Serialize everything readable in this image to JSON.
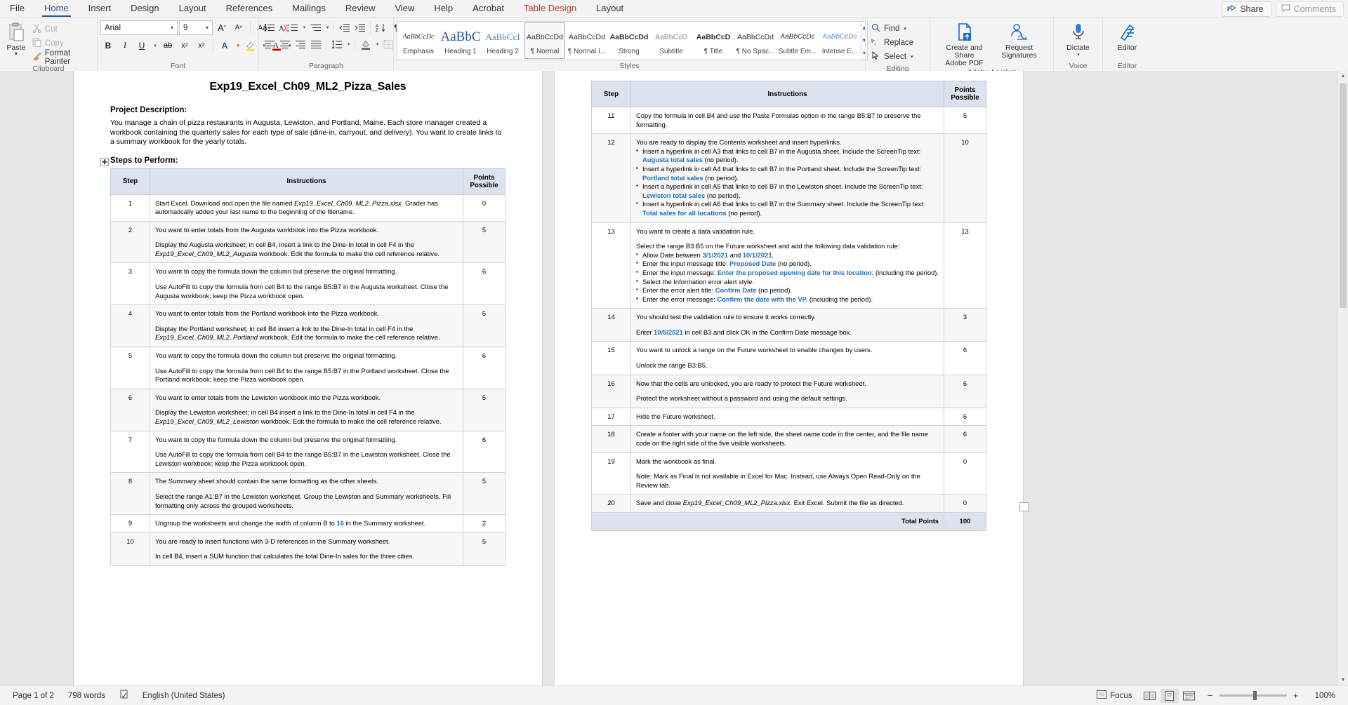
{
  "tabs": [
    {
      "label": "File",
      "state": "normal"
    },
    {
      "label": "Home",
      "state": "active"
    },
    {
      "label": "Insert",
      "state": "normal"
    },
    {
      "label": "Design",
      "state": "normal"
    },
    {
      "label": "Layout",
      "state": "normal"
    },
    {
      "label": "References",
      "state": "normal"
    },
    {
      "label": "Mailings",
      "state": "normal"
    },
    {
      "label": "Review",
      "state": "normal"
    },
    {
      "label": "View",
      "state": "normal"
    },
    {
      "label": "Help",
      "state": "normal"
    },
    {
      "label": "Acrobat",
      "state": "normal"
    }
  ],
  "contextual_tabs": [
    {
      "label": "Table Design"
    },
    {
      "label": "Layout"
    }
  ],
  "window_buttons": {
    "share": "Share",
    "comments": "Comments"
  },
  "ribbon": {
    "clipboard": {
      "label": "Clipboard",
      "paste": "Paste",
      "cut": "Cut",
      "copy": "Copy",
      "format_painter": "Format Painter"
    },
    "font": {
      "label": "Font",
      "font_name": "Arial",
      "font_size": "9",
      "grow_font": "A",
      "shrink_font": "A",
      "change_case": "Aa",
      "clear_formatting": "clear",
      "bold": "B",
      "italic": "I",
      "underline": "U",
      "strikethrough": "ab",
      "subscript": "x",
      "superscript": "x",
      "text_effects": "A",
      "highlight": "pen",
      "font_color": "A"
    },
    "paragraph": {
      "label": "Paragraph"
    },
    "styles": {
      "label": "Styles",
      "items": [
        {
          "preview": "AaBbCcDc",
          "name": "Emphasis",
          "style": "italic-serif",
          "selected": false
        },
        {
          "preview": "AaBbC",
          "name": "Heading 1",
          "style": "h1",
          "selected": false
        },
        {
          "preview": "AaBbCcI",
          "name": "Heading 2",
          "style": "h2",
          "selected": false
        },
        {
          "preview": "AaBbCcDd",
          "name": "¶ Normal",
          "style": "normal",
          "selected": true
        },
        {
          "preview": "AaBbCcDd",
          "name": "¶ Normal I...",
          "style": "normal",
          "selected": false
        },
        {
          "preview": "AaBbCcDd",
          "name": "Strong",
          "style": "bold",
          "selected": false
        },
        {
          "preview": "AaBbCcD",
          "name": "Subtitle",
          "style": "subtitle",
          "selected": false
        },
        {
          "preview": "AaBbCcD",
          "name": "¶ Title",
          "style": "bold",
          "selected": false
        },
        {
          "preview": "AaBbCcDd",
          "name": "¶ No Spac...",
          "style": "normal",
          "selected": false
        },
        {
          "preview": "AaBbCcDc",
          "name": "Subtle Em...",
          "style": "italic",
          "selected": false
        },
        {
          "preview": "AaBbCcDc",
          "name": "Intense E...",
          "style": "italic-blue",
          "selected": false
        }
      ]
    },
    "editing": {
      "label": "Editing",
      "find": "Find",
      "replace": "Replace",
      "select": "Select"
    },
    "acrobat": {
      "label": "Adobe Acrobat",
      "create_share": "Create and Share\nAdobe PDF",
      "create_share_l1": "Create and Share",
      "create_share_l2": "Adobe PDF",
      "request_sig_l1": "Request",
      "request_sig_l2": "Signatures"
    },
    "voice": {
      "label": "Voice",
      "dictate": "Dictate"
    },
    "editor": {
      "label": "Editor",
      "editor": "Editor"
    }
  },
  "document": {
    "title": "Exp19_Excel_Ch09_ML2_Pizza_Sales",
    "project_description_heading": "Project Description:",
    "project_description_body": "You manage a chain of pizza restaurants in Augusta, Lewiston, and Portland, Maine. Each store manager created a workbook containing the quarterly sales for each type of sale (dine-in, carryout, and delivery). You want to create links to a summary workbook for the yearly totals.",
    "steps_heading": "Steps to Perform:",
    "table_headers": {
      "step": "Step",
      "instructions": "Instructions",
      "points": "Points Possible",
      "points_l1": "Points",
      "points_l2": "Possible"
    },
    "total_points_label": "Total Points",
    "total_points_value": "100",
    "steps_page1": [
      {
        "step": "1",
        "points": "0",
        "paras": [
          [
            {
              "t": "Start Excel. Download and open the file named ",
              "s": "n"
            },
            {
              "t": "Exp19_Excel_Ch09_ML2_Pizza.xlsx",
              "s": "i"
            },
            {
              "t": ". Grader has automatically added your last name to the beginning of the filename.",
              "s": "n"
            }
          ]
        ]
      },
      {
        "step": "2",
        "points": "5",
        "paras": [
          [
            {
              "t": "You want to  enter totals from the Augusta workbook into the Pizza workbook.",
              "s": "n"
            }
          ],
          [
            {
              "t": "Display the Augusta worksheet; in cell B4, insert a link to the Dine-In total in cell F4 in the ",
              "s": "n"
            },
            {
              "t": "Exp19_Excel_Ch09_ML2_Augusta",
              "s": "i"
            },
            {
              "t": " workbook. Edit the formula to make the cell reference relative.",
              "s": "n"
            }
          ]
        ]
      },
      {
        "step": "3",
        "points": "6",
        "paras": [
          [
            {
              "t": "You want to  copy the formula down the column but preserve the original formatting.",
              "s": "n"
            }
          ],
          [
            {
              "t": "Use AutoFill to copy the formula from cell B4 to the range B5:B7 in the Augusta worksheet. Close the Augusta workbook; keep the Pizza workbook open.",
              "s": "n"
            }
          ]
        ]
      },
      {
        "step": "4",
        "points": "5",
        "paras": [
          [
            {
              "t": "You want to  enter totals from the Portland workbook into the Pizza workbook.",
              "s": "n"
            }
          ],
          [
            {
              "t": "Display the Portland worksheet; in cell B4 insert a link to the Dine-In total in cell F4 in the ",
              "s": "n"
            },
            {
              "t": "Exp19_Excel_Ch09_ML2_Portland",
              "s": "i"
            },
            {
              "t": " workbook. Edit the formula to make the cell reference relative.",
              "s": "n"
            }
          ]
        ]
      },
      {
        "step": "5",
        "points": "6",
        "paras": [
          [
            {
              "t": "You want to  copy the formula down the column but preserve the original formatting.",
              "s": "n"
            }
          ],
          [
            {
              "t": "Use AutoFill to copy the formula from cell B4 to the range B5:B7 in the Portland worksheet. Close the Portland workbook; keep the Pizza workbook open.",
              "s": "n"
            }
          ]
        ]
      },
      {
        "step": "6",
        "points": "5",
        "paras": [
          [
            {
              "t": "You want to  enter totals from the Lewiston workbook into the Pizza workbook.",
              "s": "n"
            }
          ],
          [
            {
              "t": "Display the Lewiston worksheet; in cell B4 insert a link to the Dine-In total in cell F4 in the ",
              "s": "n"
            },
            {
              "t": "Exp19_Excel_Ch09_ML2_Lewiston",
              "s": "i"
            },
            {
              "t": " workbook. Edit the formula to make the cell reference relative.",
              "s": "n"
            }
          ]
        ]
      },
      {
        "step": "7",
        "points": "6",
        "paras": [
          [
            {
              "t": "You want to  copy the formula down the column but preserve the original formatting.",
              "s": "n"
            }
          ],
          [
            {
              "t": "Use AutoFill to copy the formula from cell B4 to the range B5:B7 in the Lewiston worksheet. Close the Lewiston workbook; keep the Pizza workbook open.",
              "s": "n"
            }
          ]
        ]
      },
      {
        "step": "8",
        "points": "5",
        "paras": [
          [
            {
              "t": "The Summary sheet should contain the same formatting as the other sheets.",
              "s": "n"
            }
          ],
          [
            {
              "t": "Select the range A1:B7 in the Lewiston worksheet. Group the Lewiston and Summary worksheets. Fill formatting only across the grouped worksheets.",
              "s": "n"
            }
          ]
        ]
      },
      {
        "step": "9",
        "points": "2",
        "paras": [
          [
            {
              "t": "Ungroup the worksheets and change the width of column B to ",
              "s": "n"
            },
            {
              "t": "16",
              "s": "l"
            },
            {
              "t": " in the Summary worksheet.",
              "s": "n"
            }
          ]
        ]
      },
      {
        "step": "10",
        "points": "5",
        "paras": [
          [
            {
              "t": "You are ready to insert functions with 3-D references in the Summary worksheet.",
              "s": "n"
            }
          ],
          [
            {
              "t": "In cell B4, insert a SUM function that calculates the total Dine-In sales for the three cities.",
              "s": "n"
            }
          ]
        ]
      }
    ],
    "steps_page2": [
      {
        "step": "11",
        "points": "5",
        "paras": [
          [
            {
              "t": "Copy the formula in cell B4 and use the Paste Formulas option in the range B5:B7 to preserve the formatting.",
              "s": "n"
            }
          ]
        ]
      },
      {
        "step": "12",
        "points": "10",
        "paras": [
          [
            {
              "t": "You are ready to display the Contents worksheet and insert hyperlinks.",
              "s": "n"
            }
          ]
        ],
        "bullets": [
          [
            {
              "t": "Insert a hyperlink in cell A3 that links to cell B7 in the Augusta sheet. Include the ScreenTip text: ",
              "s": "n"
            },
            {
              "t": "Augusta total sales",
              "s": "l"
            },
            {
              "t": " (no period).",
              "s": "n"
            }
          ],
          [
            {
              "t": "Insert a hyperlink in cell A4 that links to cell B7 in the Portland sheet. Include the ScreenTip text: ",
              "s": "n"
            },
            {
              "t": "Portland total sales",
              "s": "l"
            },
            {
              "t": " (no period).",
              "s": "n"
            }
          ],
          [
            {
              "t": "Insert a hyperlink in cell A5 that links to cell B7 in the Lewiston sheet. Include the ScreenTip text: ",
              "s": "n"
            },
            {
              "t": "Lewiston total sales",
              "s": "l"
            },
            {
              "t": " (no period).",
              "s": "n"
            }
          ],
          [
            {
              "t": "Insert a hyperlink in cell A6 that links to cell B7 in the Summary sheet. Include the ScreenTip text: ",
              "s": "n"
            },
            {
              "t": "Total sales for all locations",
              "s": "l"
            },
            {
              "t": " (no period).",
              "s": "n"
            }
          ]
        ]
      },
      {
        "step": "13",
        "points": "13",
        "paras": [
          [
            {
              "t": "You want to create a data validation rule.",
              "s": "n"
            }
          ],
          [
            {
              "t": "Select the range B3:B5 on the Future worksheet and add the following data validation rule:",
              "s": "n"
            }
          ]
        ],
        "bullets": [
          [
            {
              "t": "Allow Date between ",
              "s": "n"
            },
            {
              "t": "3/1/2021",
              "s": "l"
            },
            {
              "t": " and ",
              "s": "n"
            },
            {
              "t": "10/1/2021",
              "s": "l"
            },
            {
              "t": ".",
              "s": "n"
            }
          ],
          [
            {
              "t": "Enter the input message title: ",
              "s": "n"
            },
            {
              "t": "Proposed Date",
              "s": "l"
            },
            {
              "t": " (no period).",
              "s": "n"
            }
          ],
          [
            {
              "t": "Enter the input message: ",
              "s": "n"
            },
            {
              "t": "Enter the proposed opening date for this location.",
              "s": "l"
            },
            {
              "t": "  (including the period).",
              "s": "n"
            }
          ],
          [
            {
              "t": "Select the Information error alert style.",
              "s": "n"
            }
          ],
          [
            {
              "t": "Enter the error alert title: ",
              "s": "n"
            },
            {
              "t": "Confirm Date",
              "s": "l"
            },
            {
              "t": " (no period).",
              "s": "n"
            }
          ],
          [
            {
              "t": "Enter the error message: ",
              "s": "n"
            },
            {
              "t": "Confirm the date with the VP.",
              "s": "l"
            },
            {
              "t": " (including the period).",
              "s": "n"
            }
          ]
        ]
      },
      {
        "step": "14",
        "points": "3",
        "paras": [
          [
            {
              "t": "You should test the validation rule to ensure it works correctly.",
              "s": "n"
            }
          ],
          [
            {
              "t": "Enter ",
              "s": "n"
            },
            {
              "t": "10/5/2021",
              "s": "l"
            },
            {
              "t": " in cell B3 and click OK in the Confirm Date message box.",
              "s": "n"
            }
          ]
        ]
      },
      {
        "step": "15",
        "points": "6",
        "paras": [
          [
            {
              "t": "You want to  unlock a range on the Future worksheet to enable changes by users.",
              "s": "n"
            }
          ],
          [
            {
              "t": "Unlock the range B3:B5.",
              "s": "n"
            }
          ]
        ]
      },
      {
        "step": "16",
        "points": "6",
        "paras": [
          [
            {
              "t": "Now that the cells are unlocked, you are ready to  protect the Future worksheet.",
              "s": "n"
            }
          ],
          [
            {
              "t": "Protect the worksheet without a password and using the default settings.",
              "s": "n"
            }
          ]
        ]
      },
      {
        "step": "17",
        "points": "6",
        "paras": [
          [
            {
              "t": "Hide the Future worksheet.",
              "s": "n"
            }
          ]
        ]
      },
      {
        "step": "18",
        "points": "6",
        "paras": [
          [
            {
              "t": "Create a footer with your name on the left side, the sheet name code in the center, and the file name code on the right side of the five visible worksheets.",
              "s": "n"
            }
          ]
        ]
      },
      {
        "step": "19",
        "points": "0",
        "paras": [
          [
            {
              "t": "Mark the workbook as final.",
              "s": "n"
            }
          ],
          [
            {
              "t": "Note: Mark as Final is not available in Excel for Mac. Instead, use Always Open Read-Only on the Review tab.",
              "s": "n"
            }
          ]
        ]
      },
      {
        "step": "20",
        "points": "0",
        "paras": [
          [
            {
              "t": "Save and close ",
              "s": "n"
            },
            {
              "t": "Exp19_Excel_Ch09_ML2_Pizza.xlsx",
              "s": "i"
            },
            {
              "t": ". Exit Excel. Submit the file as directed.",
              "s": "n"
            }
          ]
        ]
      }
    ]
  },
  "status_bar": {
    "page": "Page 1 of 2",
    "words": "798 words",
    "proofing_icon": "proofing-icon",
    "language": "English (United States)",
    "focus": "Focus",
    "zoom_value": "100%",
    "zoom_out": "−",
    "zoom_in": "+"
  },
  "colors": {
    "accent": "#2b579a",
    "link": "#1f6fb5",
    "table_header": "#dce3ef",
    "contextual": "#b83b1d"
  }
}
